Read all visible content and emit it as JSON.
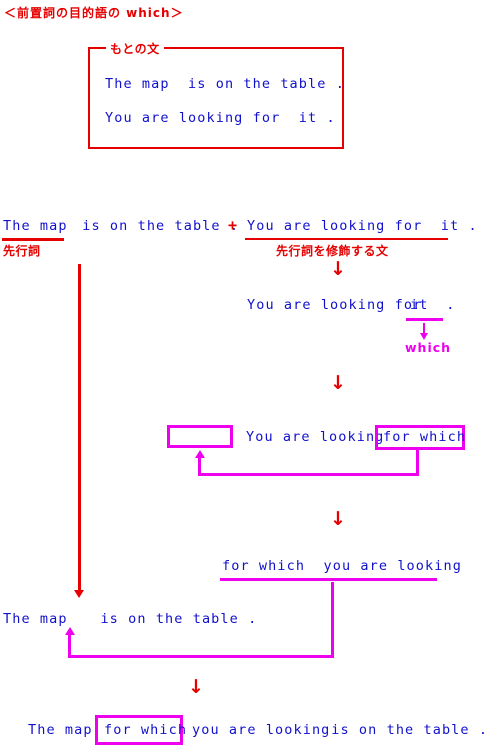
{
  "page": {
    "title": "＜前置詞の目的語の which＞",
    "colors": {
      "red": "#e60000",
      "blue": "#1111cc",
      "magenta": "#ee00ee",
      "background": "#ffffff"
    }
  },
  "original_box": {
    "legend": "もとの文",
    "sentences": [
      "The map  is on the table .",
      "You are looking for  it ."
    ]
  },
  "step_combine": {
    "left_clause": "The map",
    "left_rest": " is on the table .",
    "plus": "+",
    "right_clause": "You are looking for  it .",
    "left_label": "先行詞",
    "right_label": "先行詞を修飾する文"
  },
  "step_pronoun": {
    "arrow": "↓",
    "sentence_before": "You are looking for ",
    "pronoun": "it",
    "sentence_after": " .",
    "replacement_arrow": "↓",
    "replacement": "which"
  },
  "step_move": {
    "arrow": "↓",
    "gap_box": "",
    "subject": "You are looking",
    "moved_phrase": "for which"
  },
  "step_reordered": {
    "arrow": "↓",
    "clause": "for which  you are looking"
  },
  "step_antecedent": {
    "sentence_start": "The map",
    "sentence_end": "  is on the table ."
  },
  "step_final": {
    "arrow": "↓",
    "prefix": "The map",
    "boxed": "for which",
    "middle": "you are looking",
    "suffix": " is on the table ."
  }
}
